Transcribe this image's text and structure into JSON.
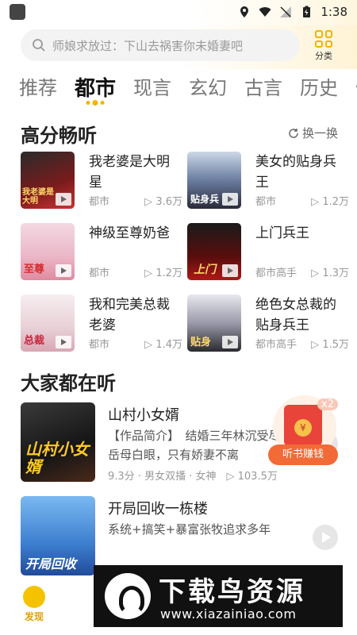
{
  "status_bar": {
    "time": "1:38"
  },
  "search": {
    "placeholder": "师娘求放过：下山去祸害你未婚妻吧"
  },
  "category": {
    "label": "分类"
  },
  "tabs": [
    {
      "label": "推荐"
    },
    {
      "label": "都市"
    },
    {
      "label": "现言"
    },
    {
      "label": "玄幻"
    },
    {
      "label": "古言"
    },
    {
      "label": "历史"
    },
    {
      "label": "仙"
    }
  ],
  "high_score": {
    "title": "高分畅听",
    "refresh_label": "换一换",
    "books": [
      {
        "title": "我老婆是大明星",
        "genre": "都市",
        "plays": "3.6万",
        "cover_text": "我老婆是大明"
      },
      {
        "title": "美女的贴身兵王",
        "genre": "都市",
        "plays": "1.2万",
        "cover_text": "贴身兵"
      },
      {
        "title": "神级至尊奶爸",
        "genre": "都市",
        "plays": "1.2万",
        "cover_text": "至尊"
      },
      {
        "title": "上门兵王",
        "genre": "都市高手",
        "plays": "1.3万",
        "cover_text": "上门"
      },
      {
        "title": "我和完美总裁老婆",
        "genre": "都市",
        "plays": "1.4万",
        "cover_text": "总裁"
      },
      {
        "title": "绝色女总裁的贴身兵王",
        "genre": "都市高手",
        "plays": "1.5万",
        "cover_text": "贴身"
      }
    ]
  },
  "everyone": {
    "title": "大家都在听",
    "items": [
      {
        "title": "山村小女婿",
        "desc": "【作品简介】　结婚三年林沉受尽岳母白眼，只有娇妻不离",
        "score": "9.3分",
        "tags": "男女双播 · 女神",
        "plays": "103.5万",
        "cover_text": "山村小女婿"
      },
      {
        "title": "开局回收一栋楼",
        "desc": "系统+搞笑+暴富张牧追求多年",
        "cover_text": "开局回收"
      }
    ]
  },
  "float_reward": {
    "badge": "x2",
    "label": "听书赚钱",
    "coin": "¥"
  },
  "bottom_nav": {
    "discover": "发现"
  },
  "watermark": {
    "title": "下载鸟资源",
    "url": "www.xiazainiao.com"
  },
  "colors": {
    "accent": "#f5b400",
    "reward": "#f26a36"
  }
}
